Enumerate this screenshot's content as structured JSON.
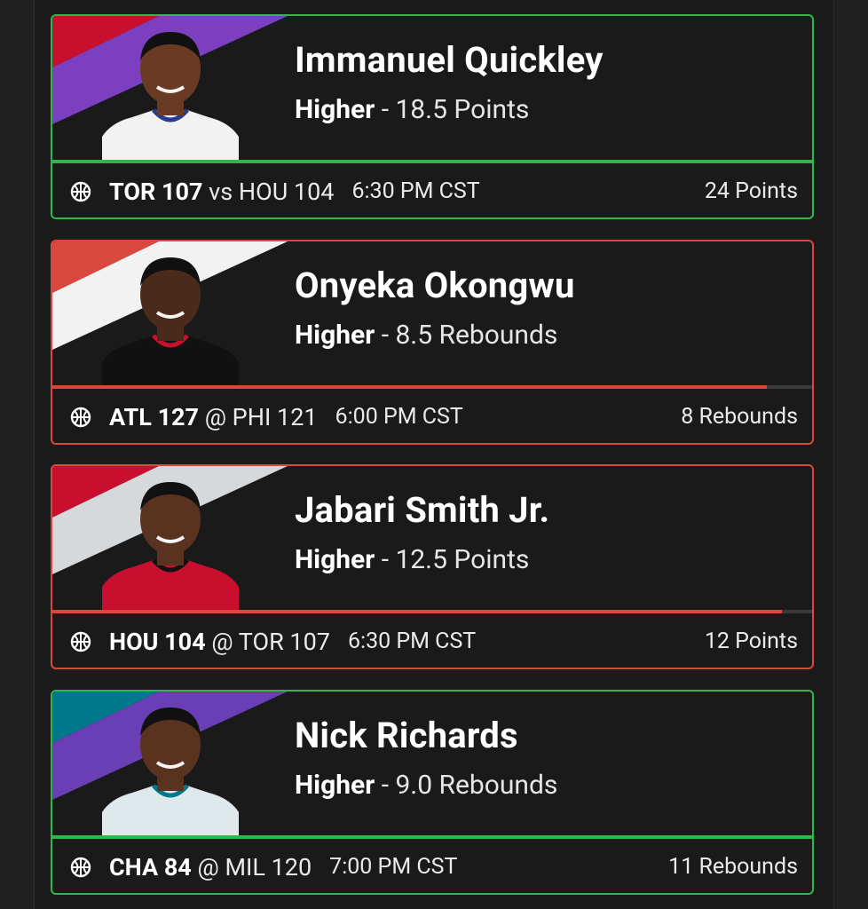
{
  "picks": [
    {
      "name": "Immanuel Quickley",
      "direction": "Higher",
      "separator": " - ",
      "line": "18.5 Points",
      "team_bold": "TOR 107",
      "matchup": " vs HOU 104",
      "time": "6:30 PM CST",
      "result": "24 Points",
      "status": "hit",
      "progress": 1.0,
      "stripe_colors": [
        "#c8102e",
        "#7b3fbf"
      ],
      "jersey": "#f2f2f2",
      "trim": "#2a3a8a",
      "skin": "#6b3a24"
    },
    {
      "name": "Onyeka Okongwu",
      "direction": "Higher",
      "separator": " - ",
      "line": "8.5 Rebounds",
      "team_bold": "ATL 127",
      "matchup": " @ PHI 121",
      "time": "6:00 PM CST",
      "result": "8 Rebounds",
      "status": "miss",
      "progress": 0.94,
      "stripe_colors": [
        "#d9473d",
        "#f2f2f2"
      ],
      "jersey": "#111111",
      "trim": "#c8102e",
      "skin": "#4a2a1a"
    },
    {
      "name": "Jabari Smith Jr.",
      "direction": "Higher",
      "separator": " - ",
      "line": "12.5 Points",
      "team_bold": "HOU 104",
      "matchup": " @ TOR 107",
      "time": "6:30 PM CST",
      "result": "12 Points",
      "status": "miss",
      "progress": 0.96,
      "stripe_colors": [
        "#c8102e",
        "#d6d9dc"
      ],
      "jersey": "#c8102e",
      "trim": "#111111",
      "skin": "#5a3320"
    },
    {
      "name": "Nick Richards",
      "direction": "Higher",
      "separator": " - ",
      "line": "9.0 Rebounds",
      "team_bold": "CHA 84",
      "matchup": " @ MIL 120",
      "time": "7:00 PM CST",
      "result": "11 Rebounds",
      "status": "hit",
      "progress": 1.0,
      "stripe_colors": [
        "#00788c",
        "#6a3fb5"
      ],
      "jersey": "#dfe9ec",
      "trim": "#00788c",
      "skin": "#5a3320"
    }
  ],
  "colors": {
    "hit": "#2fb84a",
    "miss": "#d9473d"
  },
  "icons": {
    "sport": "basketball-icon"
  }
}
